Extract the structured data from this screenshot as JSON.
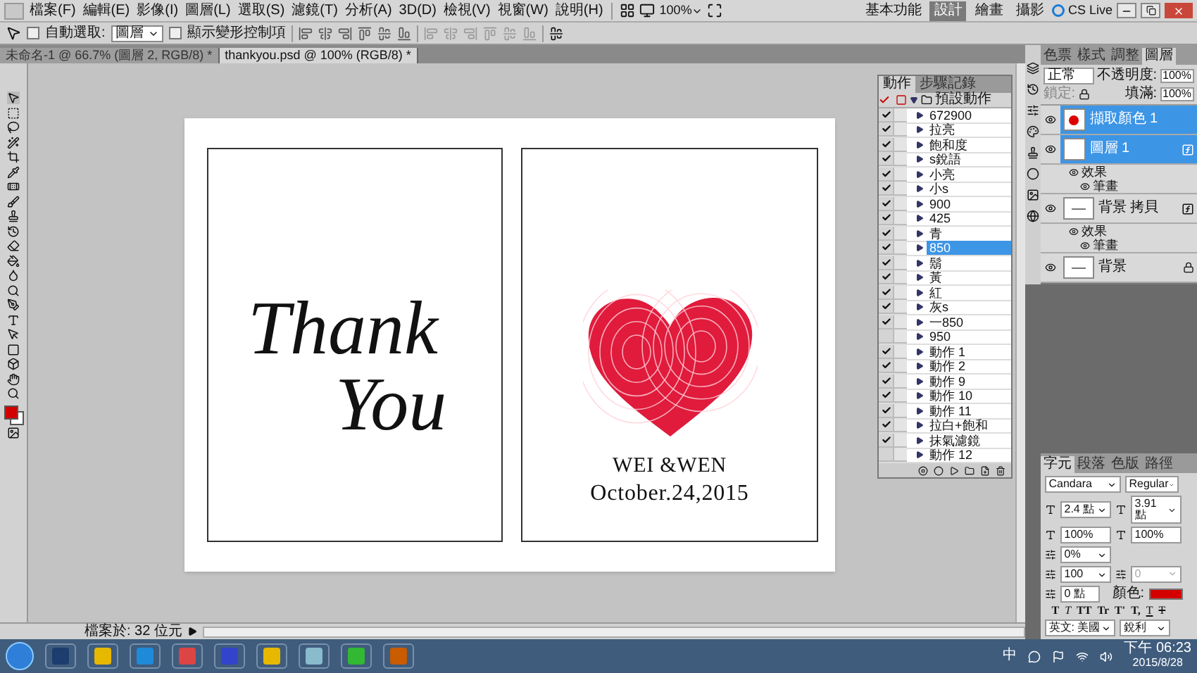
{
  "menu_bar": {
    "items": [
      "檔案(F)",
      "編輯(E)",
      "影像(I)",
      "圖層(L)",
      "選取(S)",
      "濾鏡(T)",
      "分析(A)",
      "3D(D)",
      "檢視(V)",
      "視窗(W)",
      "說明(H)"
    ],
    "zoom": "100%",
    "workspaces": [
      {
        "label": "基本功能",
        "selected": false
      },
      {
        "label": "設計",
        "selected": true
      },
      {
        "label": "繪畫",
        "selected": false
      },
      {
        "label": "攝影",
        "selected": false
      }
    ],
    "cs_live": "CS Live"
  },
  "options_bar": {
    "auto_select_label": "自動選取:",
    "auto_select_checked": false,
    "auto_select_value": "圖層",
    "show_transform_label": "顯示變形控制項",
    "show_transform_checked": false
  },
  "document_tabs": [
    {
      "label": "未命名-1 @ 66.7% (圖層 2, RGB/8) *",
      "selected": false
    },
    {
      "label": "thankyou.psd @ 100% (RGB/8) *",
      "selected": true
    }
  ],
  "canvas": {
    "left_card": {
      "line_1": "Thank",
      "line_2": "You"
    },
    "right_card": {
      "names": "WEI &WEN",
      "date": "October.24,2015"
    }
  },
  "actions_panel": {
    "tabs": [
      {
        "label": "動作",
        "selected": true
      },
      {
        "label": "步驟記錄",
        "selected": false
      }
    ],
    "set_name": "預設動作",
    "items": [
      {
        "label": "672900",
        "checked": true,
        "selected": false
      },
      {
        "label": "拉亮",
        "checked": true,
        "selected": false
      },
      {
        "label": "飽和度",
        "checked": true,
        "selected": false
      },
      {
        "label": "s銳語",
        "checked": true,
        "selected": false
      },
      {
        "label": "小亮",
        "checked": true,
        "selected": false
      },
      {
        "label": "小s",
        "checked": true,
        "selected": false
      },
      {
        "label": "900",
        "checked": true,
        "selected": false
      },
      {
        "label": "425",
        "checked": true,
        "selected": false
      },
      {
        "label": "青",
        "checked": true,
        "selected": false
      },
      {
        "label": "850",
        "checked": true,
        "selected": true
      },
      {
        "label": "鬍",
        "checked": true,
        "selected": false
      },
      {
        "label": "黃",
        "checked": true,
        "selected": false
      },
      {
        "label": "紅",
        "checked": true,
        "selected": false
      },
      {
        "label": "灰s",
        "checked": true,
        "selected": false
      },
      {
        "label": "一850",
        "checked": true,
        "selected": false
      },
      {
        "label": "950",
        "checked": false,
        "selected": false
      },
      {
        "label": "動作 1",
        "checked": true,
        "selected": false
      },
      {
        "label": "動作 2",
        "checked": true,
        "selected": false
      },
      {
        "label": "動作 9",
        "checked": true,
        "selected": false
      },
      {
        "label": "動作 10",
        "checked": true,
        "selected": false
      },
      {
        "label": "動作 11",
        "checked": true,
        "selected": false
      },
      {
        "label": "拉白+飽和",
        "checked": true,
        "selected": false
      },
      {
        "label": "抹氣濾鏡",
        "checked": true,
        "selected": false
      },
      {
        "label": "動作 12",
        "checked": false,
        "selected": false
      }
    ]
  },
  "layers_panel": {
    "tabs": [
      {
        "label": "色票",
        "selected": false
      },
      {
        "label": "樣式",
        "selected": false
      },
      {
        "label": "調整",
        "selected": false
      },
      {
        "label": "圖層",
        "selected": true
      }
    ],
    "blend_mode": "正常",
    "opacity_label": "不透明度:",
    "opacity": "100%",
    "lock_label": "鎖定:",
    "fill_label": "填滿:",
    "fill": "100%",
    "layers": [
      {
        "name": "擷取顏色 1",
        "selected": true,
        "has_fx": false,
        "kind": "heart"
      },
      {
        "name": "圖層 1",
        "selected": true,
        "has_fx": true,
        "kind": "blank",
        "effects_label": "效果",
        "effects": [
          "筆畫"
        ]
      },
      {
        "name": "背景 拷貝",
        "selected": false,
        "has_fx": true,
        "kind": "sketch",
        "effects_label": "效果",
        "effects": [
          "筆畫"
        ]
      },
      {
        "name": "背景",
        "selected": false,
        "has_fx": false,
        "kind": "sketch",
        "locked": true
      }
    ]
  },
  "character_panel": {
    "tabs": [
      {
        "label": "字元",
        "selected": true
      },
      {
        "label": "段落",
        "selected": false
      },
      {
        "label": "色版",
        "selected": false
      },
      {
        "label": "路徑",
        "selected": false
      }
    ],
    "font_family": "Candara",
    "font_style": "Regular",
    "size": "2.4 點",
    "leading": "3.91 點",
    "vertical_scale": "100%",
    "horizontal_scale": "100%",
    "scale_percent": "0%",
    "tracking": "100",
    "kerning": "0",
    "baseline": "0 點",
    "color_label": "顏色:",
    "color": "#d40000",
    "style_buttons": [
      "T",
      "T",
      "TT",
      "Tr",
      "T'",
      "T,",
      "T",
      "T"
    ],
    "language": "英文: 美國",
    "antialias": "銳利"
  },
  "status_bar": {
    "info": "檔案於: 32 位元"
  },
  "taskbar": {
    "ime": "中",
    "time": "下午 06:23",
    "date": "2015/8/28"
  }
}
